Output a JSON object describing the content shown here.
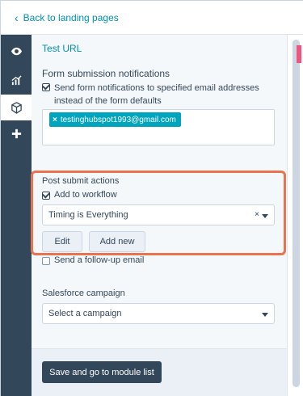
{
  "nav": {
    "back_label": "Back to landing pages"
  },
  "rail": [
    {
      "icon": "eye-icon"
    },
    {
      "icon": "chart-icon"
    },
    {
      "icon": "cube-icon"
    },
    {
      "icon": "plus-icon"
    }
  ],
  "form": {
    "test_url_label": "Test URL",
    "notifications_heading": "Form submission notifications",
    "notifications_checkbox": "Send form notifications to specified email addresses instead of the form defaults",
    "email_chip": "testinghubspot1993@gmail.com",
    "post_submit_heading": "Post submit actions",
    "add_workflow_label": "Add to workflow",
    "workflow_selected": "Timing is Everything",
    "edit_label": "Edit",
    "add_new_label": "Add new",
    "follow_up_label": "Send a follow-up email",
    "salesforce_heading": "Salesforce campaign",
    "campaign_placeholder": "Select a campaign",
    "save_label": "Save and go to module list"
  },
  "colors": {
    "accent": "#0091ae",
    "highlight": "#e8734e",
    "chip": "#00a4bd",
    "rail": "#33475b",
    "scroll_accent": "#f2547d"
  }
}
